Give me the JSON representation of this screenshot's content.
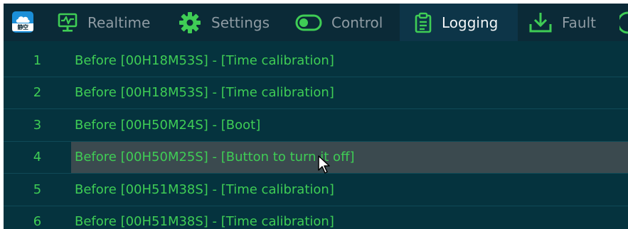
{
  "app": {
    "logo_text": "静空",
    "logo_icon": "cloud-icon"
  },
  "nav": {
    "tabs": [
      {
        "id": "realtime",
        "label": "Realtime",
        "icon": "monitor-chart-icon",
        "active": false
      },
      {
        "id": "settings",
        "label": "Settings",
        "icon": "gear-icon",
        "active": false
      },
      {
        "id": "control",
        "label": "Control",
        "icon": "toggle-icon",
        "active": false
      },
      {
        "id": "logging",
        "label": "Logging",
        "icon": "clipboard-icon",
        "active": true
      },
      {
        "id": "fault",
        "label": "Fault",
        "icon": "download-icon",
        "active": false
      }
    ]
  },
  "log": {
    "rows": [
      {
        "num": "1",
        "text": "Before [00H18M53S] - [Time calibration]",
        "selected": false
      },
      {
        "num": "2",
        "text": "Before [00H18M53S] - [Time calibration]",
        "selected": false
      },
      {
        "num": "3",
        "text": "Before [00H50M24S] - [Boot]",
        "selected": false
      },
      {
        "num": "4",
        "text": "Before [00H50M25S] - [Button to turn it off]",
        "selected": true
      },
      {
        "num": "5",
        "text": "Before [00H51M38S] - [Time calibration]",
        "selected": false
      },
      {
        "num": "6",
        "text": "Before [00H51M38S] - [Time calibration]",
        "selected": false
      }
    ]
  },
  "colors": {
    "background": "#05333e",
    "nav_background": "#0b2a37",
    "active_tab": "#0d3548",
    "icon_green": "#3fcd55",
    "log_text": "#3fcd55",
    "selected_row": "#3b4a4f"
  }
}
